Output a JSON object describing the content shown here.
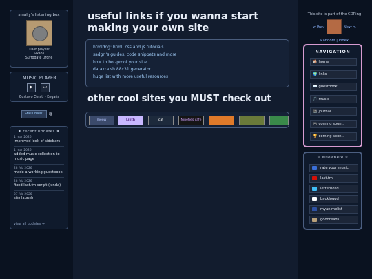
{
  "listening": {
    "title": "smally's listening box",
    "last_played_label": "last played:",
    "artist": "Swans",
    "album": "Surrogate Drone"
  },
  "player": {
    "title": "MUSIC PLAYER",
    "play": "▶",
    "skip": "⏭",
    "track": "Gustavo Cerati - Engaña"
  },
  "badge": {
    "text": "SMALLYHAND"
  },
  "updates": {
    "heading": "✦ recent updates ✦",
    "items": [
      {
        "date": "1 mar 2026",
        "text": "improved look of sidebars"
      },
      {
        "date": "1 mar 2026",
        "text": "added music collection to music page"
      },
      {
        "date": "28 feb 2026",
        "text": "made a working guestbook"
      },
      {
        "date": "28 feb 2026",
        "text": "fixed last.fm script (kinda)"
      },
      {
        "date": "27 feb 2026",
        "text": "site launch"
      }
    ],
    "view_all": "view all updates →"
  },
  "main": {
    "heading": "useful links if you wanna start making your own site",
    "links": [
      "htmldog: html, css and js tutorials",
      "sadgrl's guides, code snippets and more",
      "how to bot-proof your site",
      "datakra.sh 88x31 generator",
      "huge list with more useful resources"
    ],
    "heading2": "other cool sites you MUST check out",
    "buttons": [
      "meow",
      "Lilith",
      "cat",
      "Nineties cafe",
      "",
      "",
      ""
    ]
  },
  "ring": {
    "text": "This site is part of the CDRing",
    "prev": "< Prev",
    "next": "Next >",
    "random": "Random",
    "index": "Index"
  },
  "navigation": {
    "heading": "NAVIGATION",
    "items": [
      {
        "icon": "🏠",
        "label": "home"
      },
      {
        "icon": "🌍",
        "label": "links"
      },
      {
        "icon": "✉️",
        "label": "guestbook"
      },
      {
        "icon": "🎵",
        "label": "music"
      },
      {
        "icon": "📓",
        "label": "journal"
      },
      {
        "icon": "🎮",
        "label": "coming soon..."
      },
      {
        "icon": "🏆",
        "label": "coming soon..."
      }
    ]
  },
  "elsewhere": {
    "heading": "✧ elsewhere ✧",
    "items": [
      {
        "label": "rate your music",
        "color": "#3a6fd8"
      },
      {
        "label": "last.fm",
        "color": "#d51007"
      },
      {
        "label": "letterboxd",
        "color": "#40bcf4"
      },
      {
        "label": "backloggd",
        "color": "#ffffff"
      },
      {
        "label": "myanimelist",
        "color": "#2e51a2"
      },
      {
        "label": "goodreads",
        "color": "#b8a07a"
      }
    ]
  }
}
